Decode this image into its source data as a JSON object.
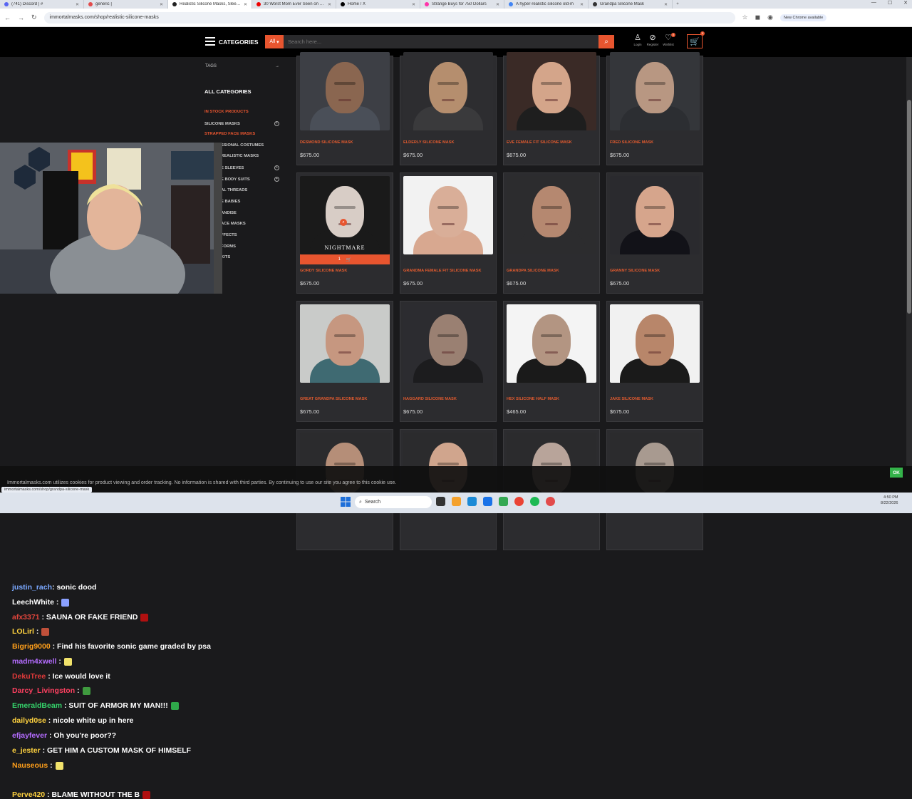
{
  "browser": {
    "tabs": [
      {
        "label": "(741) Discord | #",
        "color": "#5865f2"
      },
      {
        "label": "generic |",
        "color": "#e24b4b"
      },
      {
        "label": "Realistic Silicone Masks, Sleeve",
        "color": "#222"
      },
      {
        "label": "30 Worst Mom Ever Seen on TV",
        "color": "#e00"
      },
      {
        "label": "Home / X",
        "color": "#000"
      },
      {
        "label": "Strange Buys for 750 Dollars",
        "color": "#f3a"
      },
      {
        "label": "A hyper-realistic silicone old-m",
        "color": "#4285f4"
      },
      {
        "label": "Grandpa Silicone Mask",
        "color": "#333"
      }
    ],
    "url": "immortalmasks.com/shop/realistic-silicone-masks",
    "chrome_notice": "New Chrome available"
  },
  "header": {
    "categories_label": "CATEGORIES",
    "search_scope": "All",
    "search_placeholder": "Search here...",
    "login_label": "Login",
    "register_label": "Register",
    "wishlist_label": "Wishlist",
    "wishlist_count": "0",
    "cart_count": "0"
  },
  "sidebar": {
    "tags_label": "TAGS",
    "all_categories_label": "ALL CATEGORIES",
    "items": [
      {
        "label": "IN STOCK PRODUCTS",
        "hot": true,
        "plus": false
      },
      {
        "label": "SILICONE MASKS",
        "hot": false,
        "plus": true
      },
      {
        "label": "STRAPPED FACE MASKS",
        "hot": true,
        "plus": false
      },
      {
        "label": "SSIONAL COSTUMES",
        "hot": false,
        "plus": false
      },
      {
        "label": "REALISTIC MASKS",
        "hot": false,
        "plus": false
      },
      {
        "label": "E SLEEVES",
        "hot": false,
        "plus": true
      },
      {
        "label": "E BODY SUITS",
        "hot": false,
        "plus": true
      },
      {
        "label": "AL THREADS",
        "hot": false,
        "plus": false
      },
      {
        "label": "E BABIES",
        "hot": false,
        "plus": false
      },
      {
        "label": "ANDISE",
        "hot": false,
        "plus": false
      },
      {
        "label": "ACE MASKS",
        "hot": false,
        "plus": false
      },
      {
        "label": "FFECTS",
        "hot": false,
        "plus": false
      },
      {
        "label": "FORMS",
        "hot": false,
        "plus": false
      },
      {
        "label": "KITS",
        "hot": false,
        "plus": false
      }
    ]
  },
  "products": [
    {
      "name": "DESMOND SILICONE MASK",
      "price": "$675.00",
      "skin": "#8a6650",
      "bg": "#3d3f45",
      "shirt": "#4a4f58"
    },
    {
      "name": "ELDERLY SILICONE MASK",
      "price": "$675.00",
      "skin": "#b58e6e",
      "bg": "#2d2d30",
      "shirt": "#3a3a3c"
    },
    {
      "name": "EVE FEMALE FIT SILICONE MASK",
      "price": "$675.00",
      "skin": "#d4a58a",
      "bg": "#3a2a26",
      "shirt": "#1e1e1e"
    },
    {
      "name": "FRED SILICONE MASK",
      "price": "$675.00",
      "skin": "#b89782",
      "bg": "#34363a",
      "shirt": "#2c2e32"
    },
    {
      "name": "GORDY SILICONE MASK",
      "price": "$675.00",
      "skin": "#d8cdc6",
      "bg": "#1a1a1a",
      "shirt": "#1a1a1a",
      "label": "NIGHTMARE",
      "qty": "1"
    },
    {
      "name": "GRANDMA FEMALE FIT SILICONE MASK",
      "price": "$675.00",
      "skin": "#d9ae98",
      "bg": "#f2f2f2",
      "shirt": "#d8a890"
    },
    {
      "name": "GRANDPA SILICONE MASK",
      "price": "$675.00",
      "skin": "#b58870",
      "bg": "#2c2c2e",
      "shirt": "#2c2c2e"
    },
    {
      "name": "GRANNY SILICONE MASK",
      "price": "$675.00",
      "skin": "#d6a58c",
      "bg": "#2a2a2e",
      "shirt": "#121218"
    },
    {
      "name": "GREAT GRANDPA SILICONE MASK",
      "price": "$675.00",
      "skin": "#c69780",
      "bg": "#c9cbc9",
      "shirt": "#3f6a72"
    },
    {
      "name": "HAGGARD SILICONE MASK",
      "price": "$675.00",
      "skin": "#9a8072",
      "bg": "#2c2c30",
      "shirt": "#1c1c1e"
    },
    {
      "name": "HEX SILICONE HALF MASK",
      "price": "$465.00",
      "skin": "#b39582",
      "bg": "#f4f4f4",
      "shirt": "#1a1a1a"
    },
    {
      "name": "JAKE SILICONE MASK",
      "price": "$675.00",
      "skin": "#b8866a",
      "bg": "#f1f1f1",
      "shirt": "#1a1a1a"
    },
    {
      "name": "",
      "price": "",
      "skin": "#b58e78",
      "bg": "#2b2b2d",
      "shirt": "#2b2b2d"
    },
    {
      "name": "",
      "price": "",
      "skin": "#d0a58d",
      "bg": "#2b2b2d",
      "shirt": "#2b2b2d"
    },
    {
      "name": "",
      "price": "",
      "skin": "#b8a49a",
      "bg": "#2b2b2d",
      "shirt": "#2b2b2d"
    },
    {
      "name": "",
      "price": "",
      "skin": "#a89a90",
      "bg": "#2b2b2d",
      "shirt": "#2b2b2d"
    }
  ],
  "chat": [
    {
      "user": "justin_rach",
      "color": "#7aa8ff",
      "msg": ": sonic dood",
      "emote": ""
    },
    {
      "user": "LeechWhite",
      "color": "#ffffff",
      "msg": " :",
      "emote": "#8aa0ff"
    },
    {
      "user": "afx3371",
      "color": "#e2453c",
      "msg": " : SAUNA OR FAKE FRIEND",
      "emote": "#b01010"
    },
    {
      "user": "LOLirl",
      "color": "#ffd23f",
      "msg": " :",
      "emote": "#c0503a"
    },
    {
      "user": "Bigrig9000",
      "color": "#ff9f1a",
      "msg": " : Find his favorite sonic game graded by psa",
      "emote": ""
    },
    {
      "user": "madm4xwell",
      "color": "#b46cff",
      "msg": " :",
      "emote": "#f1e26b"
    },
    {
      "user": "DekuTree",
      "color": "#e23a3a",
      "msg": " : Ice would love it",
      "emote": ""
    },
    {
      "user": "Darcy_Livingston",
      "color": "#ff4060",
      "msg": " :",
      "emote": "#3f9a3f"
    },
    {
      "user": "EmeraldBeam",
      "color": "#35d36b",
      "msg": " : SUIT OF ARMOR MY MAN!!!",
      "emote": "#2fa84a"
    },
    {
      "user": "dailyd0se",
      "color": "#ffd23f",
      "msg": " : nicole white up in here",
      "emote": ""
    },
    {
      "user": "efjayfever",
      "color": "#b46cff",
      "msg": " : Oh you're poor??",
      "emote": ""
    },
    {
      "user": "e_jester",
      "color": "#ffd23f",
      "msg": " : GET HIM A CUSTOM MASK OF HIMSELF",
      "emote": ""
    },
    {
      "user": "Nauseous",
      "color": "#ff9f1a",
      "msg": " :",
      "emote": "#f1e26b"
    },
    {
      "user": "Perve420",
      "color": "#ffd23f",
      "msg": " : BLAME WITHOUT THE B",
      "emote": "#b01010"
    }
  ],
  "cookie": {
    "text": "Immortalmasks.com utilizes cookies for product viewing and order tracking. No information is shared with third parties. By continuing to use our site you agree to this cookie use.",
    "ok_label": "OK",
    "status_url": "immortalmasks.com/shop/grandpa-silicone-mask"
  },
  "taskbar": {
    "search_label": "Search",
    "time": "4:50 PM",
    "date": "8/22/2026"
  }
}
